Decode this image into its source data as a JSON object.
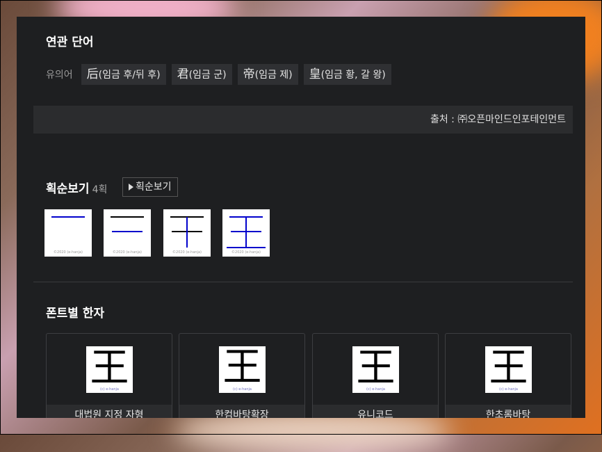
{
  "related": {
    "title": "연관 단어",
    "synonym_label": "유의어",
    "synonyms": [
      {
        "hanja": "后",
        "meaning": "(임금 후/뒤 후)"
      },
      {
        "hanja": "君",
        "meaning": "(임금 군)"
      },
      {
        "hanja": "帝",
        "meaning": "(임금 제)"
      },
      {
        "hanja": "皇",
        "meaning": "(임금 황, 갈 왕)"
      }
    ],
    "source": "출처 : ㈜오픈마인드인포테인먼트"
  },
  "strokes": {
    "title": "획순보기",
    "count": "4획",
    "button_label": "획순보기",
    "copyright": "©2020 (e-hanja)"
  },
  "fonts": {
    "title": "폰트별 한자",
    "character": "王",
    "watermark": "(c) e-hanja",
    "cards": [
      {
        "name": "대법원 지정 자형"
      },
      {
        "name": "한컴바탕확장"
      },
      {
        "name": "유니코드"
      },
      {
        "name": "한초롬바탕"
      }
    ]
  },
  "colors": {
    "panel_bg": "#1e1f21",
    "chip_bg": "#2f3033",
    "stroke_blue": "#0000cc"
  }
}
